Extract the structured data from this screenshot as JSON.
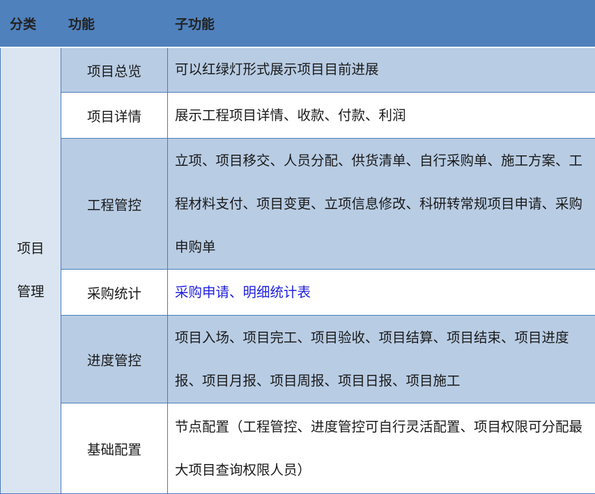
{
  "header": {
    "category": "分类",
    "function": "功能",
    "sub_function": "子功能"
  },
  "category": {
    "line1": "项目",
    "line2": "管理"
  },
  "rows": [
    {
      "function": "项目总览",
      "sub": "可以红绿灯形式展示项目目前进展"
    },
    {
      "function": "项目详情",
      "sub": "展示工程项目详情、收款、付款、利润"
    },
    {
      "function": "工程管控",
      "sub": "立项、项目移交、人员分配、供货清单、自行采购单、施工方案、工程材料支付、项目变更、立项信息修改、科研转常规项目申请、采购申购单"
    },
    {
      "function": "采购统计",
      "sub": "采购申请、明细统计表"
    },
    {
      "function": "进度管控",
      "sub": "项目入场、项目完工、项目验收、项目结算、项目结束、项目进度报、项目月报、项目周报、项目日报、项目施工"
    },
    {
      "function": "基础配置",
      "sub": "节点配置（工程管控、进度管控可自行灵活配置、项目权限可分配最大项目查询权限人员）"
    }
  ],
  "colors": {
    "header_bg": "#4f81bd",
    "shade_bg": "#b8cce4",
    "category_bg": "#dbe5f1",
    "link_text": "#1f1fe0"
  }
}
